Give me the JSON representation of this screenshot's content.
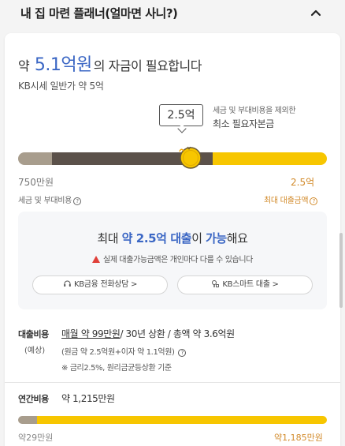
{
  "header": {
    "title": "내 집 마련 플래너(얼마면 사니?)",
    "chevron_icon": "chevron-up-icon"
  },
  "summary": {
    "prefix": "약",
    "amount": "5.1억원",
    "suffix": "의 자금이 필요합니다",
    "subline": "KB시세 일반가 약 5억"
  },
  "slider": {
    "tooltip": "2.5억",
    "annotation_small": "세금 및 부대비용을 제외한",
    "annotation_main": "최소 필요자본금",
    "left_value": "750만원",
    "left_caption": "세금 및 부대비용",
    "right_value": "2.5억",
    "right_caption": "최대 대출금액",
    "help_icon": "question-circle-icon",
    "segments_fraction": {
      "tax": 0.11,
      "capital": 0.52,
      "loan": 0.37
    },
    "colors": {
      "tax": "#a89d8d",
      "capital": "#5b514a",
      "loan": "#f7c600",
      "handle": "#f7c600"
    }
  },
  "loan_box": {
    "title_pre": "최대 ",
    "title_amount": "약 2.5억 대출",
    "title_mid": "이 ",
    "title_possible": "가능",
    "title_post": "해요",
    "warning": "실제 대출가능금액은 개인마다 다를 수 있습니다",
    "button_phone": "KB금융 전화상담 >",
    "button_smart": "KB스마트 대출 >"
  },
  "loan_cost": {
    "label": "대출비용",
    "label_sub": "(예상)",
    "monthly": "매월 약 99만원",
    "rest": "/ 30년 상환 / 총액 약 3.6억원",
    "detail": "(원금 약 2.5억원+이자 약 1.1억원)",
    "note": "※ 금리2.5%, 원리금균등상환 기준"
  },
  "annual_cost": {
    "label": "연간비용",
    "value": "약 1,215만원",
    "left_value": "약29만원",
    "right_value": "약1,185만원",
    "segments_fraction": {
      "left": 0.06,
      "right": 0.94
    },
    "colors": {
      "left": "#a89d8d",
      "right": "#f7c600"
    }
  }
}
